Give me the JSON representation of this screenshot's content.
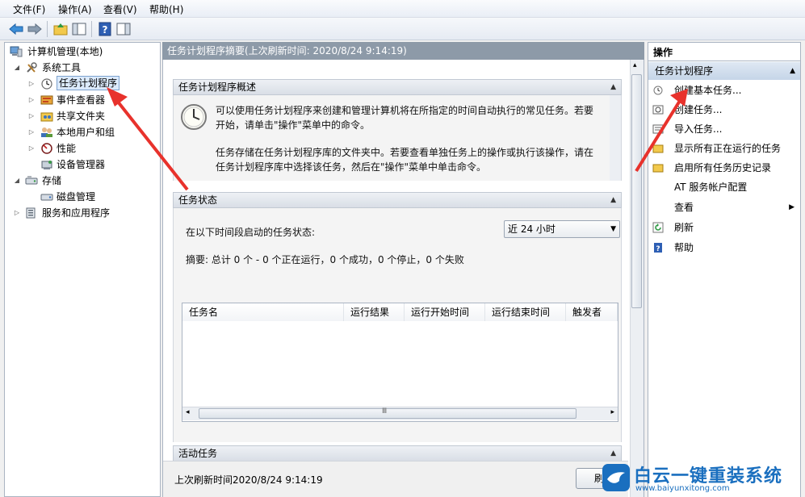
{
  "menubar": {
    "file": "文件(F)",
    "action": "操作(A)",
    "view": "查看(V)",
    "help": "帮助(H)"
  },
  "tree": {
    "root": "计算机管理(本地)",
    "system_tools": "系统工具",
    "task_scheduler": "任务计划程序",
    "event_viewer": "事件查看器",
    "shared_folders": "共享文件夹",
    "local_users": "本地用户和组",
    "performance": "性能",
    "device_manager": "设备管理器",
    "storage": "存储",
    "disk_management": "磁盘管理",
    "services_apps": "服务和应用程序"
  },
  "middle": {
    "header": "任务计划程序摘要(上次刷新时间: 2020/8/24 9:14:19)",
    "overview_title": "任务计划程序概述",
    "overview_p1_l1": "可以使用任务计划程序来创建和管理计算机将在所指定的时间自动执行的常见任务。若要",
    "overview_p1_l2": "开始，请单击\"操作\"菜单中的命令。",
    "overview_p2_l1": "任务存储在任务计划程序库的文件夹中。若要查看单独任务上的操作或执行该操作，请在",
    "overview_p2_l2": "任务计划程序库中选择该任务，然后在\"操作\"菜单中单击命令。",
    "status_title": "任务状态",
    "status_label": "在以下时间段启动的任务状态:",
    "dropdown_value": "近 24 小时",
    "summary": "摘要: 总计 0 个 - 0 个正在运行，0 个成功，0 个停止，0 个失败",
    "columns": [
      "任务名",
      "运行结果",
      "运行开始时间",
      "运行结束时间",
      "触发者"
    ],
    "hscroll_grip": "Ⅲ",
    "active_title": "活动任务",
    "footer_text": "上次刷新时间2020/8/24 9:14:19",
    "refresh_button": "刷"
  },
  "actions": {
    "title": "操作",
    "section": "任务计划程序",
    "items": [
      {
        "label": "创建基本任务..."
      },
      {
        "label": "创建任务..."
      },
      {
        "label": "导入任务..."
      },
      {
        "label": "显示所有正在运行的任务"
      },
      {
        "label": "启用所有任务历史记录"
      },
      {
        "label": "AT 服务帐户配置"
      },
      {
        "label": "查看"
      },
      {
        "label": "刷新"
      },
      {
        "label": "帮助"
      }
    ]
  },
  "watermark": {
    "brand": "白云一键重装系统",
    "url": "www.baiyunxitong.com"
  },
  "colors": {
    "accent": "#1a6fbf",
    "arrow": "#e8322c",
    "header_gray": "#8d9aa8",
    "selection": "#dbeafc"
  }
}
